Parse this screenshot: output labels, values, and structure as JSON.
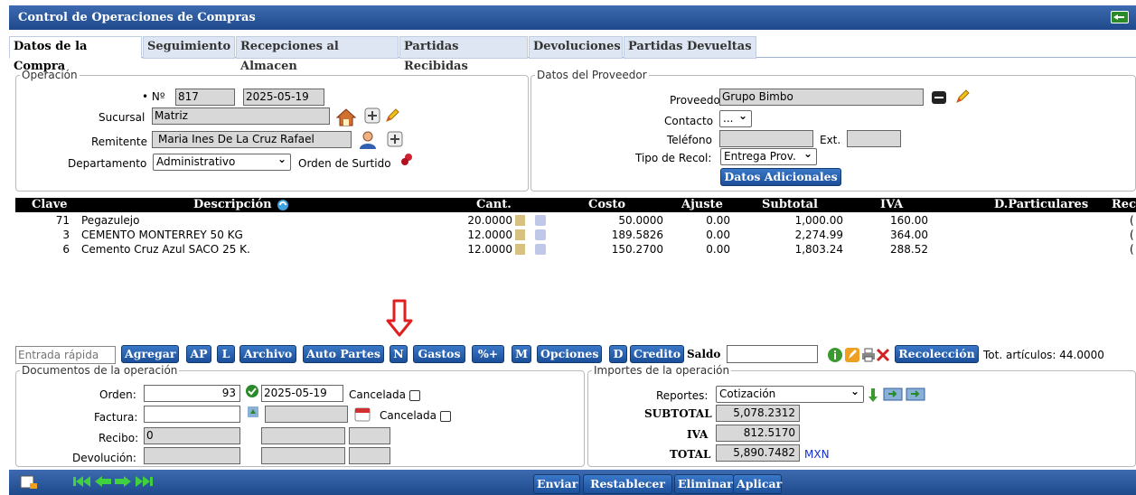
{
  "window": {
    "title": "Control de Operaciones de Compras"
  },
  "tabs": [
    "Datos de la Compra",
    "Seguimiento",
    "Recepciones al Almacen",
    "Partidas Recibidas",
    "Devoluciones",
    "Partidas Devueltas"
  ],
  "operacion": {
    "legend": "Operación",
    "no_label": "• Nº",
    "no": "817",
    "fecha": "2025-05-19",
    "sucursal_label": "Sucursal",
    "sucursal": "Matriz",
    "remitente_label": "Remitente",
    "remitente": "Maria Ines De La Cruz Rafael",
    "departamento_label": "Departamento",
    "departamento": "Administrativo",
    "orden_surtido_label": "Orden de Surtido"
  },
  "proveedor": {
    "legend": "Datos del Proveedor",
    "proveedor_label": "Proveedor",
    "proveedor": "Grupo Bimbo",
    "contacto_label": "Contacto",
    "contacto": "...",
    "telefono_label": "Teléfono",
    "telefono": "",
    "ext_label": "Ext.",
    "ext": "",
    "tipo_recol_label": "Tipo de Recol:",
    "tipo_recol": "Entrega Prov.",
    "datos_adicionales": "Datos Adicionales"
  },
  "grid": {
    "headers": [
      "Clave",
      "Descripción",
      "Cant.",
      "Costo",
      "Ajuste",
      "Subtotal",
      "IVA",
      "D.Particulares",
      "Rec"
    ],
    "rows": [
      {
        "clave": "71",
        "descripcion": "Pegazulejo",
        "cant": "20.0000",
        "costo": "50.0000",
        "ajuste": "0.00",
        "subtotal": "1,000.00",
        "iva": "160.00",
        "rec": "("
      },
      {
        "clave": "3",
        "descripcion": "CEMENTO MONTERREY 50 KG",
        "cant": "12.0000",
        "costo": "189.5826",
        "ajuste": "0.00",
        "subtotal": "2,274.99",
        "iva": "364.00",
        "rec": "("
      },
      {
        "clave": "6",
        "descripcion": "Cemento Cruz Azul SACO 25 K.",
        "cant": "12.0000",
        "costo": "150.2700",
        "ajuste": "0.00",
        "subtotal": "1,803.24",
        "iva": "288.52",
        "rec": "("
      }
    ]
  },
  "toolbar": {
    "entrada_placeholder": "Entrada rápida",
    "agregar": "Agregar",
    "ap": "AP",
    "l": "L",
    "archivo": "Archivo",
    "auto_partes": "Auto Partes",
    "n": "N",
    "gastos": "Gastos",
    "pct": "%+",
    "m": "M",
    "opciones": "Opciones",
    "d": "D",
    "credito": "Credito",
    "saldo_label": "Saldo",
    "saldo": "",
    "recoleccion": "Recolección",
    "tot_articulos": "Tot. artículos: 44.0000"
  },
  "documentos": {
    "legend": "Documentos de la operación",
    "orden_label": "Orden:",
    "orden": "93",
    "orden_fecha": "2025-05-19",
    "cancelada_label": "Cancelada",
    "factura_label": "Factura:",
    "factura": "",
    "recibo_label": "Recibo:",
    "recibo": "0",
    "devolucion_label": "Devolución:"
  },
  "importes": {
    "legend": "Importes de la operación",
    "reportes_label": "Reportes:",
    "reportes": "Cotización",
    "subtotal_label": "SUBTOTAL",
    "subtotal": "5,078.2312",
    "iva_label": "IVA",
    "iva": "812.5170",
    "total_label": "TOTAL",
    "total": "5,890.7482",
    "moneda": "MXN"
  },
  "footer": {
    "enviar": "Enviar",
    "restablecer": "Restablecer",
    "eliminar": "Eliminar",
    "aplicar": "Aplicar"
  },
  "colors": {
    "accent": "#1e4a8c",
    "arrow": "#e02020",
    "checkmark": "#2a8a2a"
  }
}
